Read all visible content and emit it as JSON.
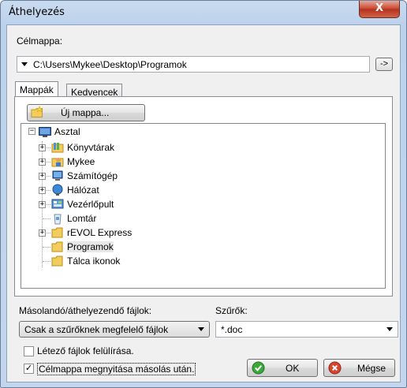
{
  "window": {
    "title": "Áthelyezés",
    "close_label": "X"
  },
  "target": {
    "label": "Célmappa:",
    "path": "C:\\Users\\Mykee\\Desktop\\Programok",
    "go_button": "->"
  },
  "tabs": [
    {
      "label": "Mappák",
      "active": true
    },
    {
      "label": "Kedvencek",
      "active": false
    }
  ],
  "new_folder_button": "Új mappa...",
  "tree": {
    "root": "Asztal",
    "items": [
      {
        "label": "Könyvtárak",
        "icon": "libraries-icon",
        "expandable": true
      },
      {
        "label": "Mykee",
        "icon": "user-folder-icon",
        "expandable": true
      },
      {
        "label": "Számítógép",
        "icon": "computer-icon",
        "expandable": true
      },
      {
        "label": "Hálózat",
        "icon": "network-icon",
        "expandable": true
      },
      {
        "label": "Vezérlőpult",
        "icon": "control-panel-icon",
        "expandable": true
      },
      {
        "label": "Lomtár",
        "icon": "recycle-bin-icon",
        "expandable": false
      },
      {
        "label": "rEVOL Express",
        "icon": "folder-icon",
        "expandable": true
      },
      {
        "label": "Programok",
        "icon": "folder-icon",
        "expandable": false,
        "selected": true
      },
      {
        "label": "Tálca ikonok",
        "icon": "folder-icon",
        "expandable": false
      }
    ]
  },
  "files_mode": {
    "label": "Másolandó/áthelyezendő fájlok:",
    "value": "Csak a szűrőknek megfelelő fájlok"
  },
  "filters": {
    "label": "Szűrők:",
    "value": "*.doc"
  },
  "options": [
    {
      "label": "Létező fájlok felülírása.",
      "checked": false
    },
    {
      "label": "Célmappa megnyitása másolás után.",
      "checked": true
    }
  ],
  "buttons": {
    "ok": "OK",
    "cancel": "Mégse"
  },
  "colors": {
    "accent": "#c7452c",
    "ok_green": "#3aa83a",
    "cancel_red": "#d9442b"
  }
}
